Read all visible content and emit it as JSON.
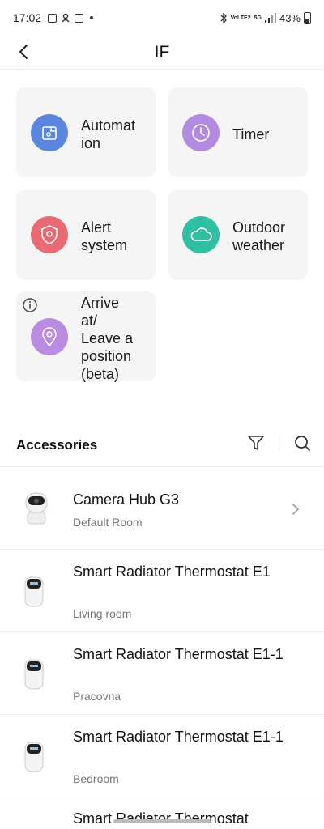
{
  "status_bar": {
    "time": "17:02",
    "network_top": "VoLTE2",
    "network_gen": "5G",
    "battery": "43%"
  },
  "header": {
    "title": "IF"
  },
  "conditions": [
    {
      "label": "Automat\nion",
      "color": "#5b86e0",
      "icon": "automation-icon"
    },
    {
      "label": "Timer",
      "color": "#b18be0",
      "icon": "clock-icon"
    },
    {
      "label": "Alert\nsystem",
      "color": "#ea6a74",
      "icon": "shield-icon"
    },
    {
      "label": "Outdoor\nweather",
      "color": "#2fbfa3",
      "icon": "cloud-icon"
    },
    {
      "label": "Arrive\nat/\nLeave a\nposition\n(beta)",
      "color": "#b98be2",
      "icon": "location-pin-icon"
    }
  ],
  "accessories": {
    "title": "Accessories",
    "items": [
      {
        "name": "Camera Hub G3",
        "room": "Default Room",
        "has_chevron": true,
        "device": "camera"
      },
      {
        "name": "Smart Radiator Thermostat E1",
        "room": "Living room",
        "has_chevron": false,
        "device": "thermostat"
      },
      {
        "name": "Smart Radiator Thermostat E1-1",
        "room": "Pracovna",
        "has_chevron": false,
        "device": "thermostat"
      },
      {
        "name": "Smart Radiator Thermostat E1-1",
        "room": "Bedroom",
        "has_chevron": false,
        "device": "thermostat"
      },
      {
        "name": "Smart Radiator Thermostat",
        "room": "",
        "has_chevron": false,
        "device": "thermostat"
      }
    ]
  }
}
